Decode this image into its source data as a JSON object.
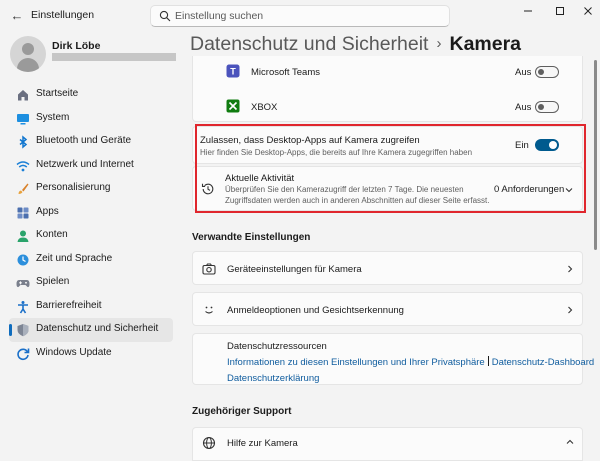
{
  "app": {
    "title": "Einstellungen"
  },
  "search": {
    "placeholder": "Einstellung suchen"
  },
  "user": {
    "name": "Dirk Löbe"
  },
  "sidebar": {
    "items": [
      {
        "label": "Startseite",
        "icon": "home-icon"
      },
      {
        "label": "System",
        "icon": "monitor-icon"
      },
      {
        "label": "Bluetooth und Geräte",
        "icon": "bluetooth-icon"
      },
      {
        "label": "Netzwerk und Internet",
        "icon": "wifi-icon"
      },
      {
        "label": "Personalisierung",
        "icon": "brush-icon"
      },
      {
        "label": "Apps",
        "icon": "apps-icon"
      },
      {
        "label": "Konten",
        "icon": "person-icon"
      },
      {
        "label": "Zeit und Sprache",
        "icon": "globe-clock-icon"
      },
      {
        "label": "Spielen",
        "icon": "gamepad-icon"
      },
      {
        "label": "Barrierefreiheit",
        "icon": "accessibility-icon"
      },
      {
        "label": "Datenschutz und Sicherheit",
        "icon": "shield-icon",
        "active": true
      },
      {
        "label": "Windows Update",
        "icon": "update-icon"
      }
    ]
  },
  "breadcrumb": {
    "parent": "Datenschutz und Sicherheit",
    "separator": "›",
    "current": "Kamera"
  },
  "apps": [
    {
      "name": "Microsoft Teams",
      "state": "Aus",
      "icon": "teams-icon"
    },
    {
      "name": "XBOX",
      "state": "Aus",
      "icon": "xbox-icon"
    }
  ],
  "desktop_apps": {
    "title": "Zulassen, dass Desktop-Apps auf Kamera zugreifen",
    "description": "Hier finden Sie Desktop-Apps, die bereits auf Ihre Kamera zugegriffen haben",
    "state": "Ein"
  },
  "activity": {
    "title": "Aktuelle Aktivität",
    "description": "Überprüfen Sie den Kamerazugriff der letzten 7 Tage. Die neuesten Zugriffsdaten werden auch in anderen Abschnitten auf dieser Seite erfasst.",
    "count": "0 Anforderungen"
  },
  "related": {
    "heading": "Verwandte Einstellungen",
    "items": [
      {
        "label": "Geräteeinstellungen für Kamera",
        "icon": "camera-icon"
      },
      {
        "label": "Anmeldeoptionen und Gesichtserkennung",
        "icon": "face-icon"
      }
    ]
  },
  "privacy_resources": {
    "title": "Datenschutzressourcen",
    "links": [
      "Informationen zu diesen Einstellungen und Ihrer Privatsphäre",
      "Datenschutz-Dashboard",
      "Datenschutzerklärung"
    ]
  },
  "support": {
    "heading": "Zugehöriger Support",
    "items": [
      {
        "label": "Hilfe zur Kamera",
        "icon": "globe-icon"
      }
    ]
  },
  "colors": {
    "accent": "#005a8e",
    "highlight": "#e0262d",
    "link": "#0f5c9e"
  }
}
